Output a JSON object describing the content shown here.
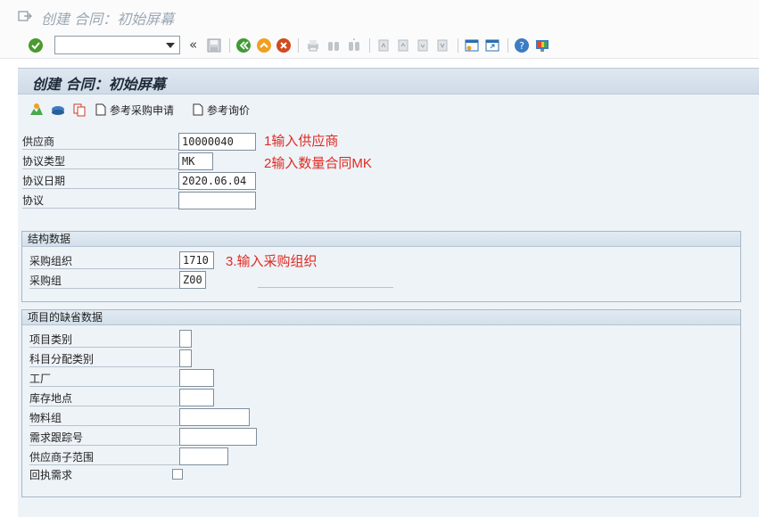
{
  "window": {
    "title": "创建 合同：初始屏幕"
  },
  "toolbar": {
    "command_field_value": ""
  },
  "screen": {
    "title": "创建 合同：初始屏幕"
  },
  "app_toolbar": {
    "ref_pr_label": "参考采购申请",
    "ref_rfq_label": "参考询价"
  },
  "header": {
    "vendor_label": "供应商",
    "vendor_value": "10000040",
    "agreement_type_label": "协议类型",
    "agreement_type_value": "MK",
    "agreement_date_label": "协议日期",
    "agreement_date_value": "2020.06.04",
    "agreement_label": "协议",
    "agreement_value": ""
  },
  "annotations": {
    "vendor_note": "1输入供应商",
    "type_note": "2输入数量合同MK",
    "purch_org_note": "3.输入采购组织"
  },
  "org_data": {
    "title": "结构数据",
    "purch_org_label": "采购组织",
    "purch_org_value": "1710",
    "purch_group_label": "采购组",
    "purch_group_value": "Z00"
  },
  "defaults": {
    "title": "项目的缺省数据",
    "item_category_label": "项目类别",
    "account_assignment_label": "科目分配类别",
    "plant_label": "工厂",
    "storage_location_label": "库存地点",
    "material_group_label": "物料组",
    "tracking_number_label": "需求跟踪号",
    "vendor_subrange_label": "供应商子范围",
    "ack_required_label": "回执需求"
  },
  "colors": {
    "annotation": "#e02a20",
    "accent": "#2b6cb0"
  }
}
